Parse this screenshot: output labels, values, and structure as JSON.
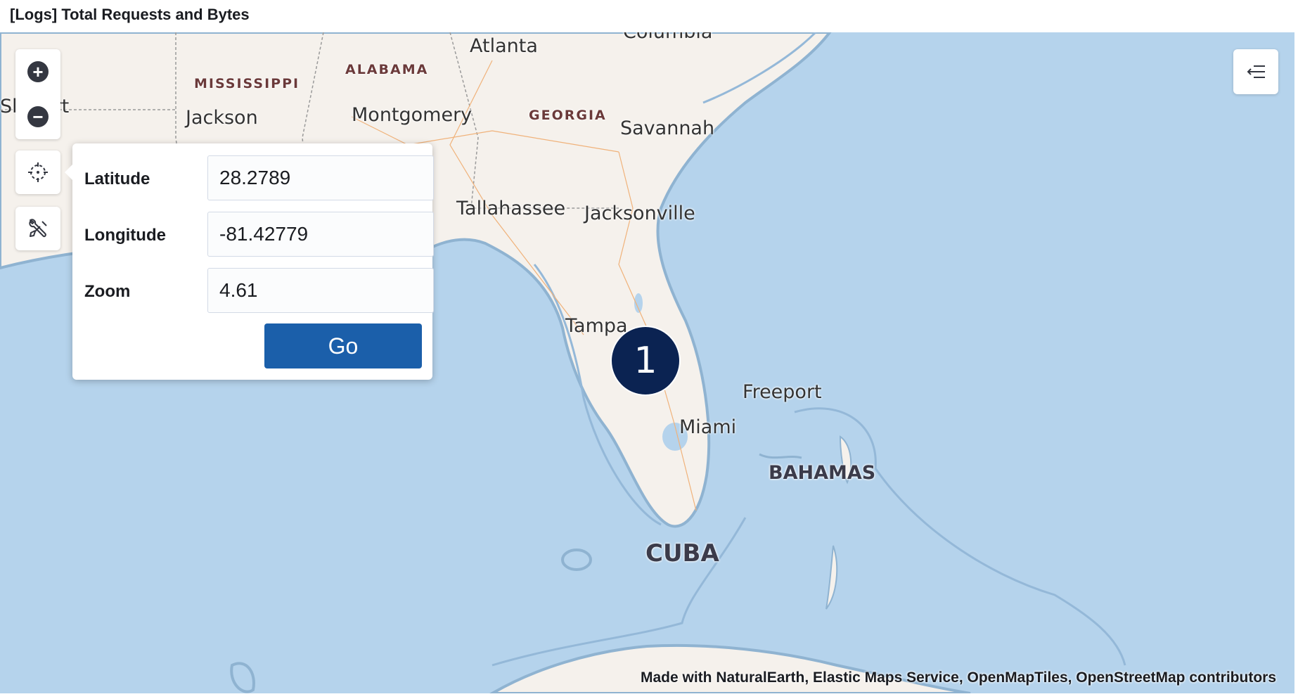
{
  "panel": {
    "title": "[Logs] Total Requests and Bytes"
  },
  "map": {
    "labels": {
      "columbia": "Columbia",
      "atlanta": "Atlanta",
      "alabama": "ALABAMA",
      "mississippi": "MISSISSIPPI",
      "shreveport": "Sh   port",
      "jackson": "Jackson",
      "montgomery": "Montgomery",
      "georgia": "GEORGIA",
      "savannah": "Savannah",
      "tallahassee": "Tallahassee",
      "jacksonville": "Jacksonville",
      "tampa": "Tampa",
      "freeport": "Freeport",
      "miami": "Miami",
      "bahamas": "BAHAMAS",
      "cuba": "CUBA"
    },
    "cluster": {
      "count": "1"
    },
    "attribution": "Made with NaturalEarth, Elastic Maps Service, OpenMapTiles, OpenStreetMap contributors",
    "colors": {
      "water": "#b5d3ec",
      "land": "#f5f1ec",
      "cluster": "#0b2352",
      "button": "#1b5faa"
    }
  },
  "controls": {
    "zoom_in_icon": "plus-circle-icon",
    "zoom_out_icon": "minus-circle-icon",
    "set_view_icon": "crosshair-icon",
    "tools_icon": "wrench-icon",
    "legend_icon": "list-collapse-icon"
  },
  "set_view": {
    "latitude_label": "Latitude",
    "latitude_value": "28.2789",
    "longitude_label": "Longitude",
    "longitude_value": "-81.42779",
    "zoom_label": "Zoom",
    "zoom_value": "4.61",
    "go_label": "Go"
  }
}
